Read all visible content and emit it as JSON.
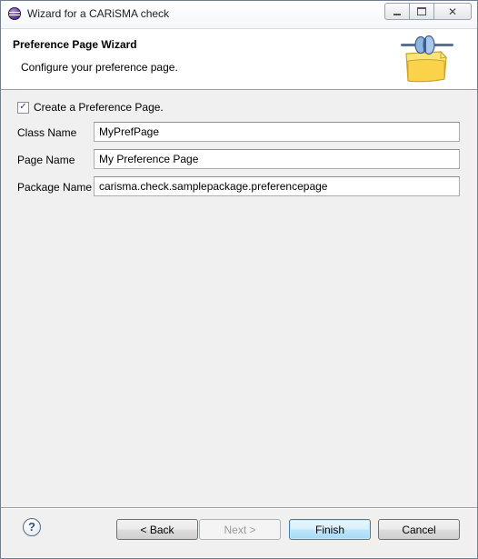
{
  "window": {
    "title": "Wizard for a CARiSMA check",
    "close_glyph": "✕"
  },
  "banner": {
    "title": "Preference Page Wizard",
    "description": "Configure your preference page.",
    "icon": "wizard-banner-icon"
  },
  "form": {
    "create_checkbox": {
      "label": "Create a Preference Page.",
      "checked": true,
      "check_glyph": "✓"
    },
    "fields": [
      {
        "label": "Class Name",
        "value": "MyPrefPage"
      },
      {
        "label": "Page Name",
        "value": "My Preference Page"
      },
      {
        "label": "Package Name",
        "value": "carisma.check.samplepackage.preferencepage"
      }
    ]
  },
  "footer": {
    "help_glyph": "?",
    "back_label": "< Back",
    "next_label": "Next >",
    "finish_label": "Finish",
    "cancel_label": "Cancel"
  },
  "colors": {
    "default_button_border": "#3c7fb1",
    "checkbox_mark": "#2b3e8f"
  }
}
